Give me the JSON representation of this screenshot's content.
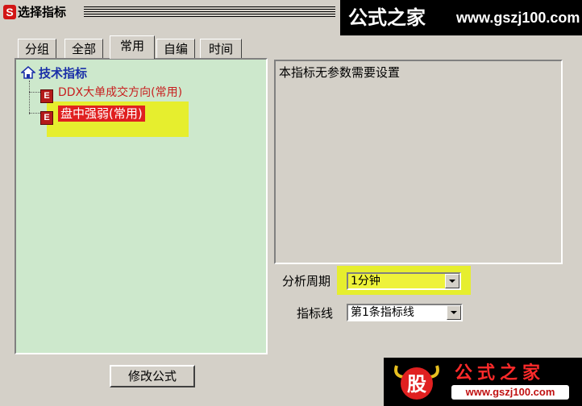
{
  "window": {
    "title": "选择指标",
    "icon_letter": "S"
  },
  "watermark_top": {
    "text": "公式之家",
    "url": "www.gszj100.com"
  },
  "tabs": [
    {
      "label": "分组"
    },
    {
      "label": "全部"
    },
    {
      "label": "常用",
      "active": true
    },
    {
      "label": "自编"
    },
    {
      "label": "时间"
    }
  ],
  "tree": {
    "root": "技术指标",
    "items": [
      {
        "label": "DDX大单成交方向(常用)",
        "selected": false
      },
      {
        "label": "盘中强弱(常用)",
        "selected": true
      }
    ]
  },
  "info": {
    "text": "本指标无参数需要设置"
  },
  "form": {
    "period_label": "分析周期",
    "period_value": "1分钟",
    "line_label": "指标线",
    "line_value": "第1条指标线"
  },
  "buttons": {
    "edit_formula": "修改公式"
  },
  "watermark_bottom": {
    "logo_char": "股",
    "text": "公式之家",
    "url": "www.gszj100.com"
  },
  "colors": {
    "dialog_bg": "#d4d0c8",
    "tree_bg": "#cde8cc",
    "highlight": "#e6ee2e",
    "selected_item": "#e02020",
    "tree_root_text": "#1a2fa8"
  }
}
